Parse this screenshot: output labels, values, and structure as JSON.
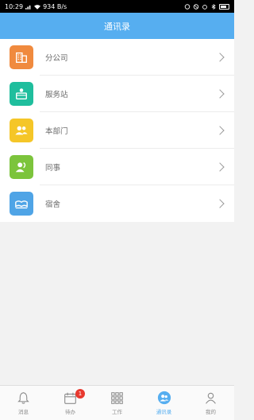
{
  "status_bar": {
    "time": "10:29",
    "network_speed": "934 B/s",
    "battery": "battery-icon"
  },
  "header": {
    "title": "通讯录"
  },
  "list": {
    "items": [
      {
        "label": "分公司",
        "icon": "building-icon",
        "color": "#f08a3e"
      },
      {
        "label": "服务站",
        "icon": "service-station-icon",
        "color": "#1fbe9d"
      },
      {
        "label": "本部门",
        "icon": "department-group-icon",
        "color": "#f5c628"
      },
      {
        "label": "同事",
        "icon": "colleague-icon",
        "color": "#7cc43c"
      },
      {
        "label": "宿舍",
        "icon": "dormitory-icon",
        "color": "#4fa4e6"
      }
    ]
  },
  "tabbar": {
    "tabs": [
      {
        "label": "消息",
        "icon": "bell-icon",
        "active": false
      },
      {
        "label": "待办",
        "icon": "calendar-icon",
        "active": false,
        "badge": "1"
      },
      {
        "label": "工作",
        "icon": "grid-icon",
        "active": false
      },
      {
        "label": "通讯录",
        "icon": "contacts-icon",
        "active": true
      },
      {
        "label": "我的",
        "icon": "person-icon",
        "active": false
      }
    ]
  },
  "colors": {
    "accent": "#56aef0",
    "badge": "#e8392f"
  }
}
